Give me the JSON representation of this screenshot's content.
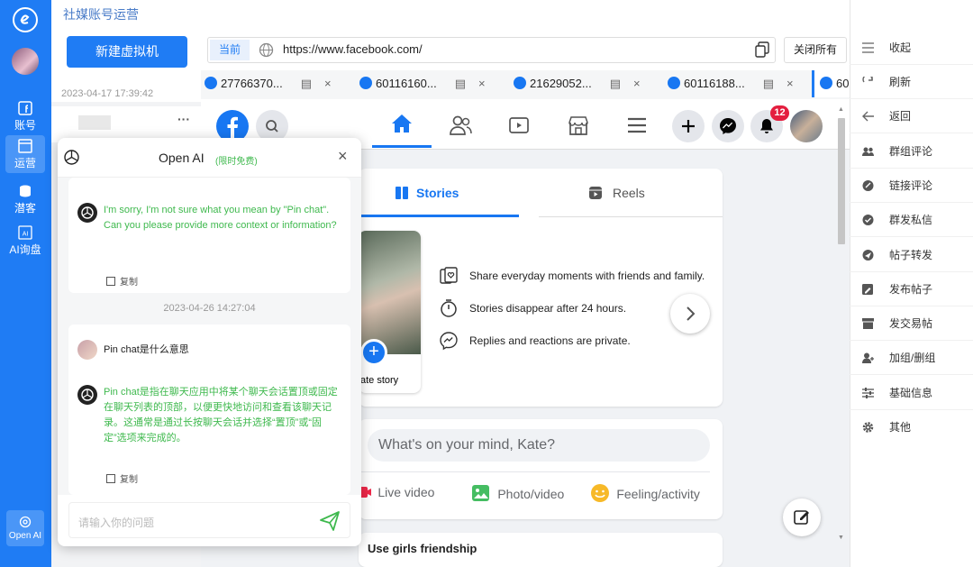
{
  "app": {
    "title": "社媒账号运营",
    "new_vm_label": "新建虚拟机",
    "date": "2023-04-17 17:39:42"
  },
  "leftnav": [
    {
      "label": "账号"
    },
    {
      "label": "运营"
    },
    {
      "label": "潜客"
    },
    {
      "label": "AI询盘"
    }
  ],
  "openai_btn": "Open AI",
  "browser": {
    "current_label": "当前",
    "url": "https://www.facebook.com/",
    "close_all": "关闭所有",
    "tabs": [
      "27766370...",
      "60116160...",
      "21629052...",
      "60116188...",
      "60"
    ]
  },
  "facebook": {
    "notif_count": "12",
    "stories_tab": "Stories",
    "reels_tab": "Reels",
    "story_lines": [
      "Share everyday moments with friends and family.",
      "Stories disappear after 24 hours.",
      "Replies and reactions are private."
    ],
    "create_story": "ate story",
    "post_placeholder": "What's on your mind, Kate?",
    "actions": [
      "Live video",
      "Photo/video",
      "Feeling/activity"
    ],
    "next_post": "Use girls friendship"
  },
  "dialog": {
    "title": "Open AI",
    "badge": "(限时免费)",
    "msg1": "I'm sorry, I'm not sure what you mean by \"Pin chat\". Can you please provide more context or information?",
    "copy": "复制",
    "timestamp": "2023-04-26 14:27:04",
    "user_q": "Pin chat是什么意思",
    "msg2": "Pin chat是指在聊天应用中将某个聊天会话置顶或固定在聊天列表的顶部，以便更快地访问和查看该聊天记录。这通常是通过长按聊天会话并选择“置顶”或“固定”选项来完成的。",
    "input_placeholder": "请输入你的问题"
  },
  "rightpanel": [
    "收起",
    "刷新",
    "返回",
    "群组评论",
    "链接评论",
    "群发私信",
    "帖子转发",
    "发布帖子",
    "发交易帖",
    "加组/删组",
    "基础信息",
    "其他"
  ],
  "colors": {
    "primary": "#1f7cf4",
    "facebook": "#1877f2",
    "ai_green": "#3fb94e"
  }
}
